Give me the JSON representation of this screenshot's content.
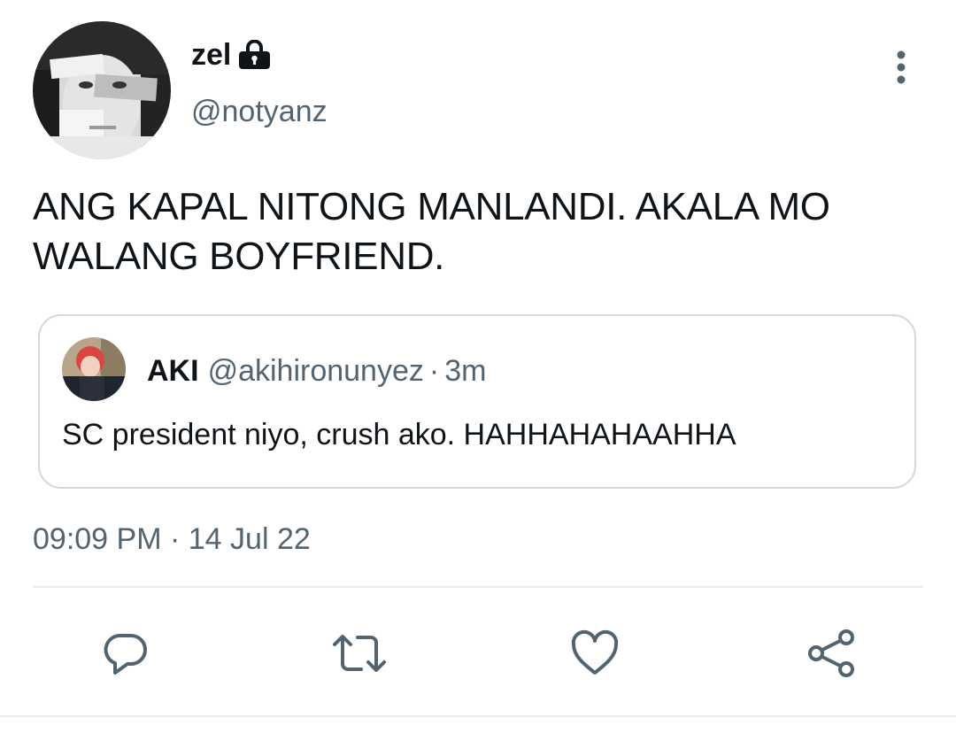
{
  "author": {
    "display_name": "zel",
    "handle": "@notyanz",
    "protected": true
  },
  "tweet": {
    "text": "ANG KAPAL NITONG MANLANDI. AKALA MO WALANG BOYFRIEND.",
    "time": "09:09 PM",
    "separator": "·",
    "date": "14 Jul 22"
  },
  "quoted_tweet": {
    "display_name": "AKI",
    "handle": "@akihironunyez",
    "separator": "·",
    "age": "3m",
    "text": "SC president niyo, crush ako. HAHHAHAHAAHHA"
  },
  "actions": {
    "icons": [
      "reply-icon",
      "retweet-icon",
      "like-icon",
      "share-icon"
    ]
  },
  "colors": {
    "text_primary": "#0f1419",
    "text_secondary": "#536471",
    "border": "#cfd9de",
    "icon": "#536471"
  }
}
